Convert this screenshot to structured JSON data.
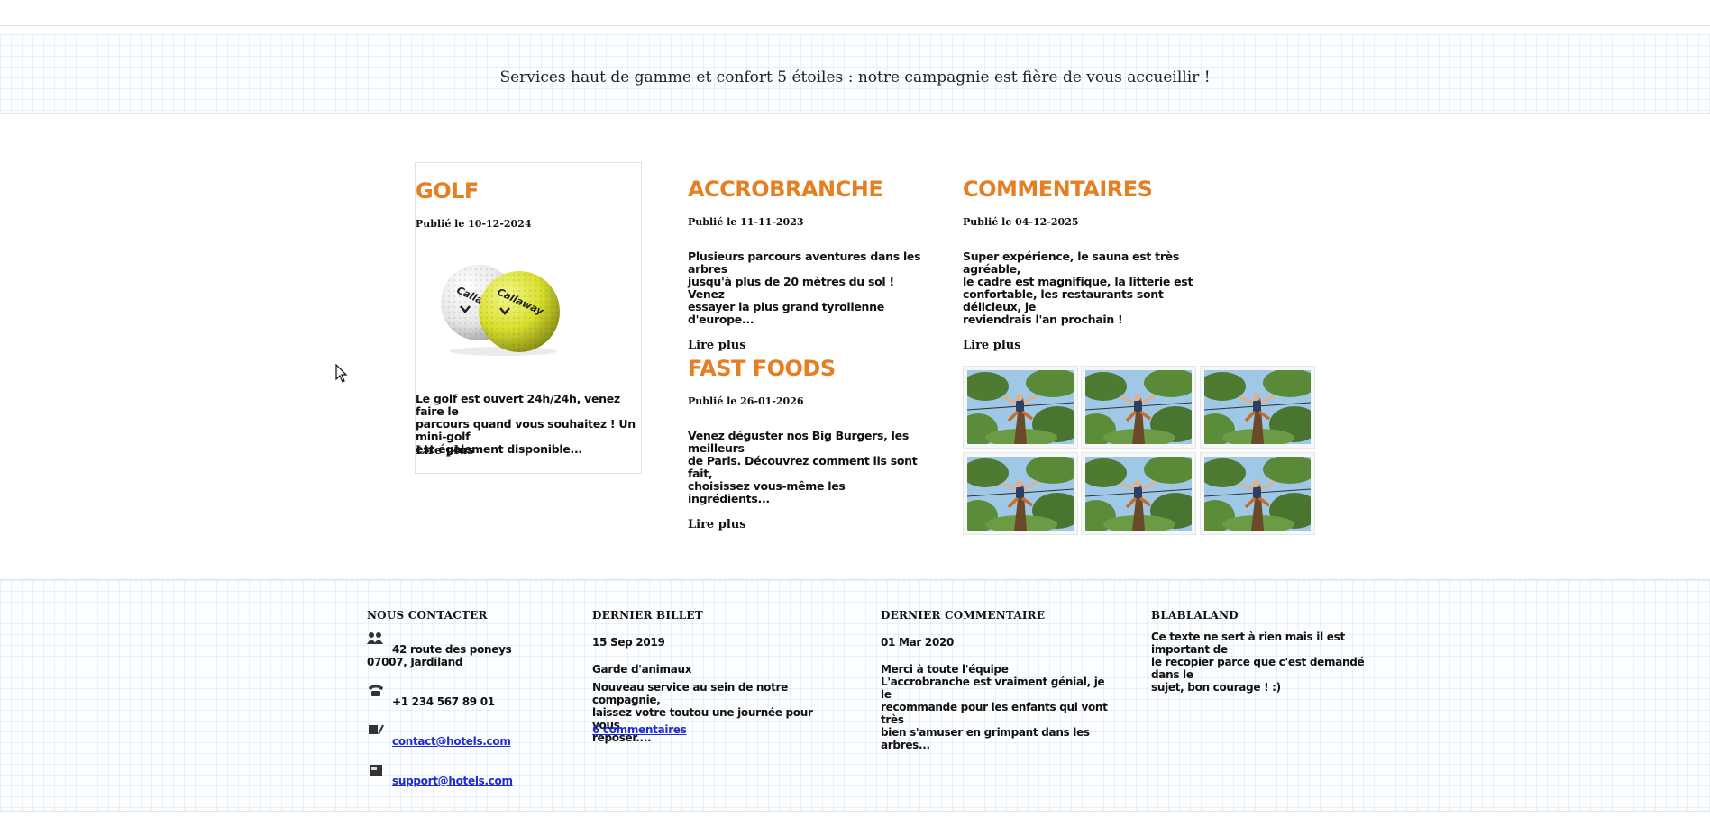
{
  "banner": {
    "text": "Services haut de gamme et confort 5 étoiles : notre campagnie est fière de vous accueillir !"
  },
  "posts": [
    {
      "title": "GOLF",
      "date": "Publié le 10-12-2024",
      "excerpt_lines": [
        "Le golf est ouvert 24h/24h, venez faire le",
        "parcours quand vous souhaitez ! Un mini-golf",
        "est également disponible..."
      ],
      "read_more": "Lire plus",
      "image_icon": "golf-balls-image"
    },
    {
      "title": "ACCROBRANCHE",
      "date": "Publié le 11-11-2023",
      "excerpt_lines": [
        "Plusieurs parcours aventures dans les arbres",
        "jusqu'à plus de 20 mètres du sol ! Venez",
        "essayer la plus grand tyrolienne d'europe..."
      ],
      "read_more": "Lire plus"
    },
    {
      "title": "FAST FOODS",
      "date": "Publié le 26-01-2026",
      "excerpt_lines": [
        "Venez déguster nos Big Burgers, les meilleurs",
        "de Paris. Découvrez comment ils sont fait,",
        "choisissez vous-même les ingrédients..."
      ],
      "read_more": "Lire plus"
    },
    {
      "title": "COMMENTAIRES",
      "date": "Publié le 04-12-2025",
      "excerpt_lines": [
        "Super expérience, le sauna est très agréable,",
        "le cadre est magnifique, la litterie est",
        "confortable, les restaurants sont délicieux, je",
        "reviendrais l'an prochain !"
      ],
      "read_more": "Lire plus"
    }
  ],
  "gallery": {
    "count": 6,
    "image_icon": "accrobranche-photo"
  },
  "footer": {
    "contact": {
      "heading": "NOUS CONTACTER",
      "address_line1": "42 route des poneys",
      "address_line2": "07007, Jardiland",
      "phone": "+1 234 567 89 01",
      "email1": "contact@hotels.com",
      "email2": "support@hotels.com",
      "icons": [
        "users-icon",
        "phone-icon",
        "email-icon",
        "fax-icon"
      ]
    },
    "last_post": {
      "heading": "DERNIER BILLET",
      "date": "15 Sep 2019",
      "title": "Garde d'animaux",
      "excerpt_lines": [
        "Nouveau service au sein de notre compagnie,",
        "laissez votre toutou une journée pour vous",
        "reposer...."
      ],
      "comments_link": "6 commentaires"
    },
    "last_comment": {
      "heading": "DERNIER COMMENTAIRE",
      "date": "01 Mar 2020",
      "title": "Merci à toute l'équipe",
      "excerpt_lines": [
        "L'accrobranche est vraiment génial, je le",
        "recommande pour les enfants qui vont très",
        "bien s'amuser en grimpant dans les arbres..."
      ]
    },
    "blabla": {
      "heading": "BLABLALAND",
      "text_lines": [
        "Ce texte ne sert à rien mais il est important de",
        "le recopier parce que c'est demandé dans le",
        "sujet, bon courage ! :)"
      ]
    }
  },
  "colors": {
    "accent": "#e67e22",
    "link": "#1f2bd6",
    "text": "#111111"
  }
}
